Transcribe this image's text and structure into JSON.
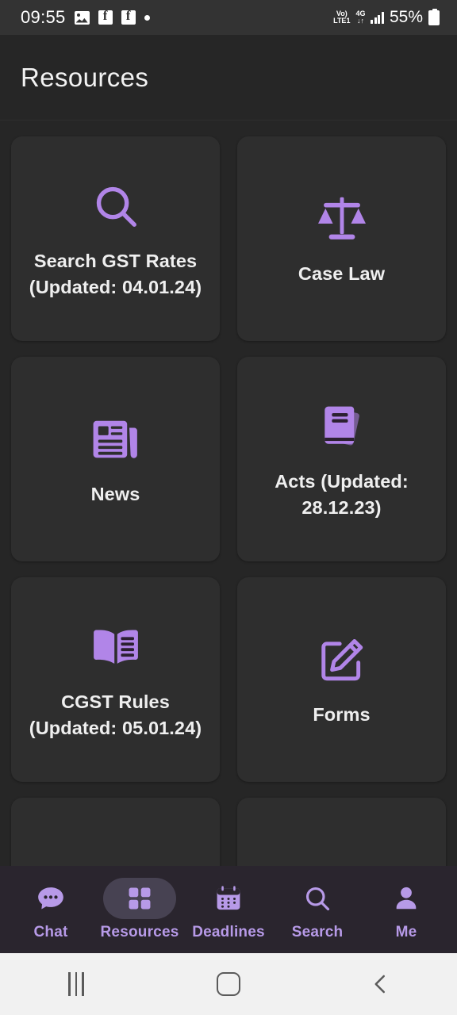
{
  "status_bar": {
    "time": "09:55",
    "icons": [
      "gallery-icon",
      "facebook-icon",
      "facebook-icon",
      "dot-icon"
    ],
    "volte_top": "Vo)",
    "volte_bottom": "LTE1",
    "network_top": "4G",
    "network_bottom": "↓↑",
    "battery_percent": "55%"
  },
  "header": {
    "title": "Resources"
  },
  "cards": [
    {
      "icon": "search-icon",
      "label": "Search GST Rates (Updated: 04.01.24)"
    },
    {
      "icon": "scales-icon",
      "label": "Case Law"
    },
    {
      "icon": "newspaper-icon",
      "label": "News"
    },
    {
      "icon": "book-closed-icon",
      "label": "Acts (Updated: 28.12.23)"
    },
    {
      "icon": "book-open-icon",
      "label": "CGST Rules (Updated: 05.01.24)"
    },
    {
      "icon": "edit-square-icon",
      "label": "Forms"
    }
  ],
  "bottom_nav": {
    "active": "Resources",
    "items": [
      {
        "label": "Chat",
        "icon": "chat-bubble-icon"
      },
      {
        "label": "Resources",
        "icon": "grid-icon"
      },
      {
        "label": "Deadlines",
        "icon": "calendar-icon"
      },
      {
        "label": "Search",
        "icon": "search-icon"
      },
      {
        "label": "Me",
        "icon": "person-icon"
      }
    ]
  },
  "system_nav": {
    "recents": "recents-button",
    "home": "home-button",
    "back": "back-button"
  },
  "colors": {
    "accent": "#b185e8",
    "page_bg": "#262626",
    "card_bg": "#2e2e2e",
    "nav_bg": "#2a252e",
    "nav_active_pill": "#474252",
    "text": "#efefef"
  }
}
